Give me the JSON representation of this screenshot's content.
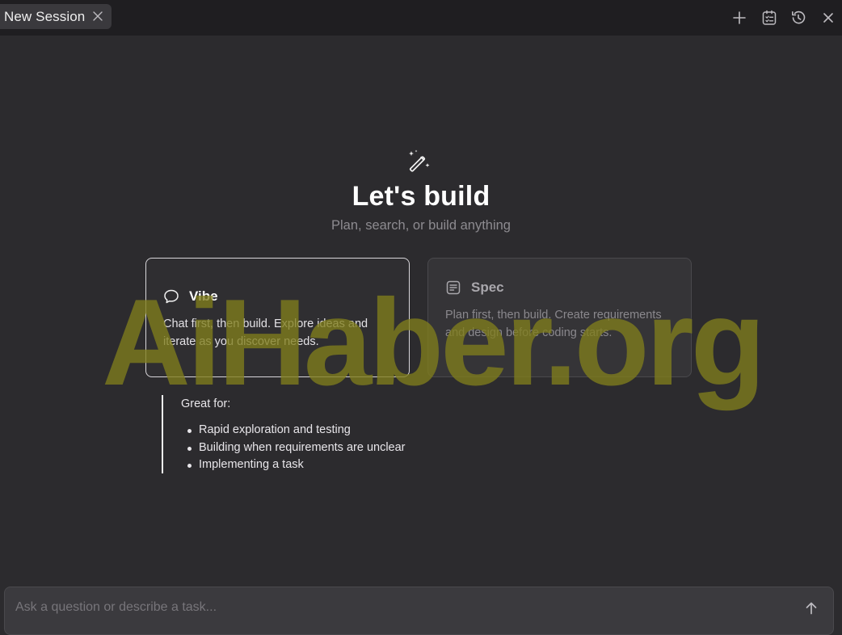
{
  "tabbar": {
    "tab_label": "New Session",
    "icons": [
      "plus-icon",
      "task-list-icon",
      "history-icon",
      "close-icon"
    ]
  },
  "hero": {
    "icon": "magic-wand-icon",
    "title": "Let's build",
    "subtitle": "Plan, search, or build anything"
  },
  "modes": {
    "vibe": {
      "icon": "chat-bubble-icon",
      "title": "Vibe",
      "description": "Chat first, then build. Explore ideas and iterate as you discover needs.",
      "selected": true
    },
    "spec": {
      "icon": "document-icon",
      "title": "Spec",
      "description": "Plan first, then build. Create requirements and design before coding starts.",
      "selected": false
    }
  },
  "great_for": {
    "title": "Great for:",
    "items": [
      "Rapid exploration and testing",
      "Building when requirements are unclear",
      "Implementing a task"
    ]
  },
  "input": {
    "placeholder": "Ask a question or describe a task...",
    "value": "",
    "send_icon": "arrow-up-icon"
  },
  "watermark": {
    "text": "AiHaber.org"
  },
  "colors": {
    "background": "#2c2b2e",
    "tabbar": "#1f1e21",
    "selected_border": "#d8d6da",
    "watermark": "#807e1c"
  }
}
